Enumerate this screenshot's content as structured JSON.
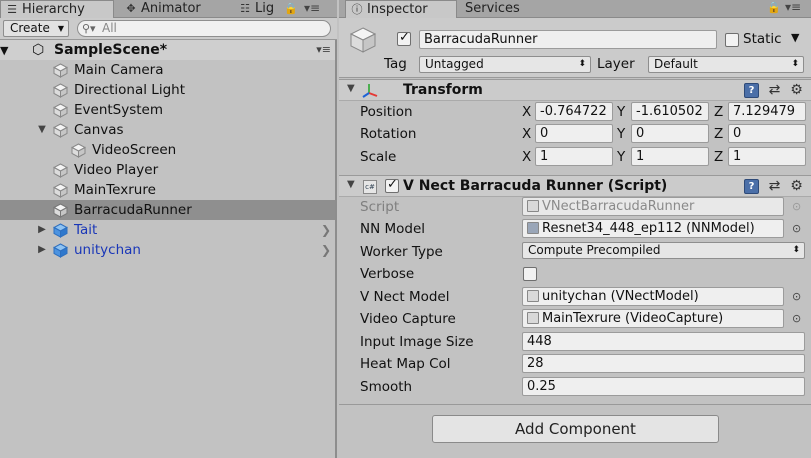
{
  "hierarchy": {
    "tabs": [
      {
        "label": "Hierarchy",
        "icon": "list-icon"
      },
      {
        "label": "Animator",
        "icon": "animator-icon"
      },
      {
        "label": "Lig",
        "icon": "lighting-icon"
      }
    ],
    "create_label": "Create",
    "search_placeholder": "All",
    "scene_name": "SampleScene*",
    "items": [
      {
        "label": "Main Camera"
      },
      {
        "label": "Directional Light"
      },
      {
        "label": "EventSystem"
      },
      {
        "label": "Canvas"
      },
      {
        "label": "VideoScreen"
      },
      {
        "label": "Video Player"
      },
      {
        "label": "MainTexrure"
      },
      {
        "label": "BarracudaRunner"
      },
      {
        "label": "Tait"
      },
      {
        "label": "unitychan"
      }
    ]
  },
  "inspector": {
    "tabs": [
      {
        "label": "Inspector",
        "icon": "info-icon"
      },
      {
        "label": "Services"
      }
    ],
    "object_name": "BarracudaRunner",
    "static_label": "Static",
    "tag_label": "Tag",
    "tag_value": "Untagged",
    "layer_label": "Layer",
    "layer_value": "Default",
    "transform": {
      "title": "Transform",
      "position_label": "Position",
      "rotation_label": "Rotation",
      "scale_label": "Scale",
      "axes": [
        "X",
        "Y",
        "Z"
      ],
      "position": [
        "-0.764722",
        "-1.610502",
        "7.129479"
      ],
      "rotation": [
        "0",
        "0",
        "0"
      ],
      "scale": [
        "1",
        "1",
        "1"
      ]
    },
    "script_component": {
      "title": "V Nect Barracuda Runner (Script)",
      "fields": [
        {
          "label": "Script",
          "value": "VNectBarracudaRunner"
        },
        {
          "label": "NN Model",
          "value": "Resnet34_448_ep112 (NNModel)"
        },
        {
          "label": "Worker Type",
          "value": "Compute Precompiled"
        },
        {
          "label": "Verbose",
          "value": ""
        },
        {
          "label": "V Nect Model",
          "value": "unitychan (VNectModel)"
        },
        {
          "label": "Video Capture",
          "value": "MainTexrure (VideoCapture)"
        },
        {
          "label": "Input Image Size",
          "value": "448"
        },
        {
          "label": "Heat Map Col",
          "value": "28"
        },
        {
          "label": "Smooth",
          "value": "0.25"
        }
      ]
    },
    "add_component_label": "Add Component"
  }
}
